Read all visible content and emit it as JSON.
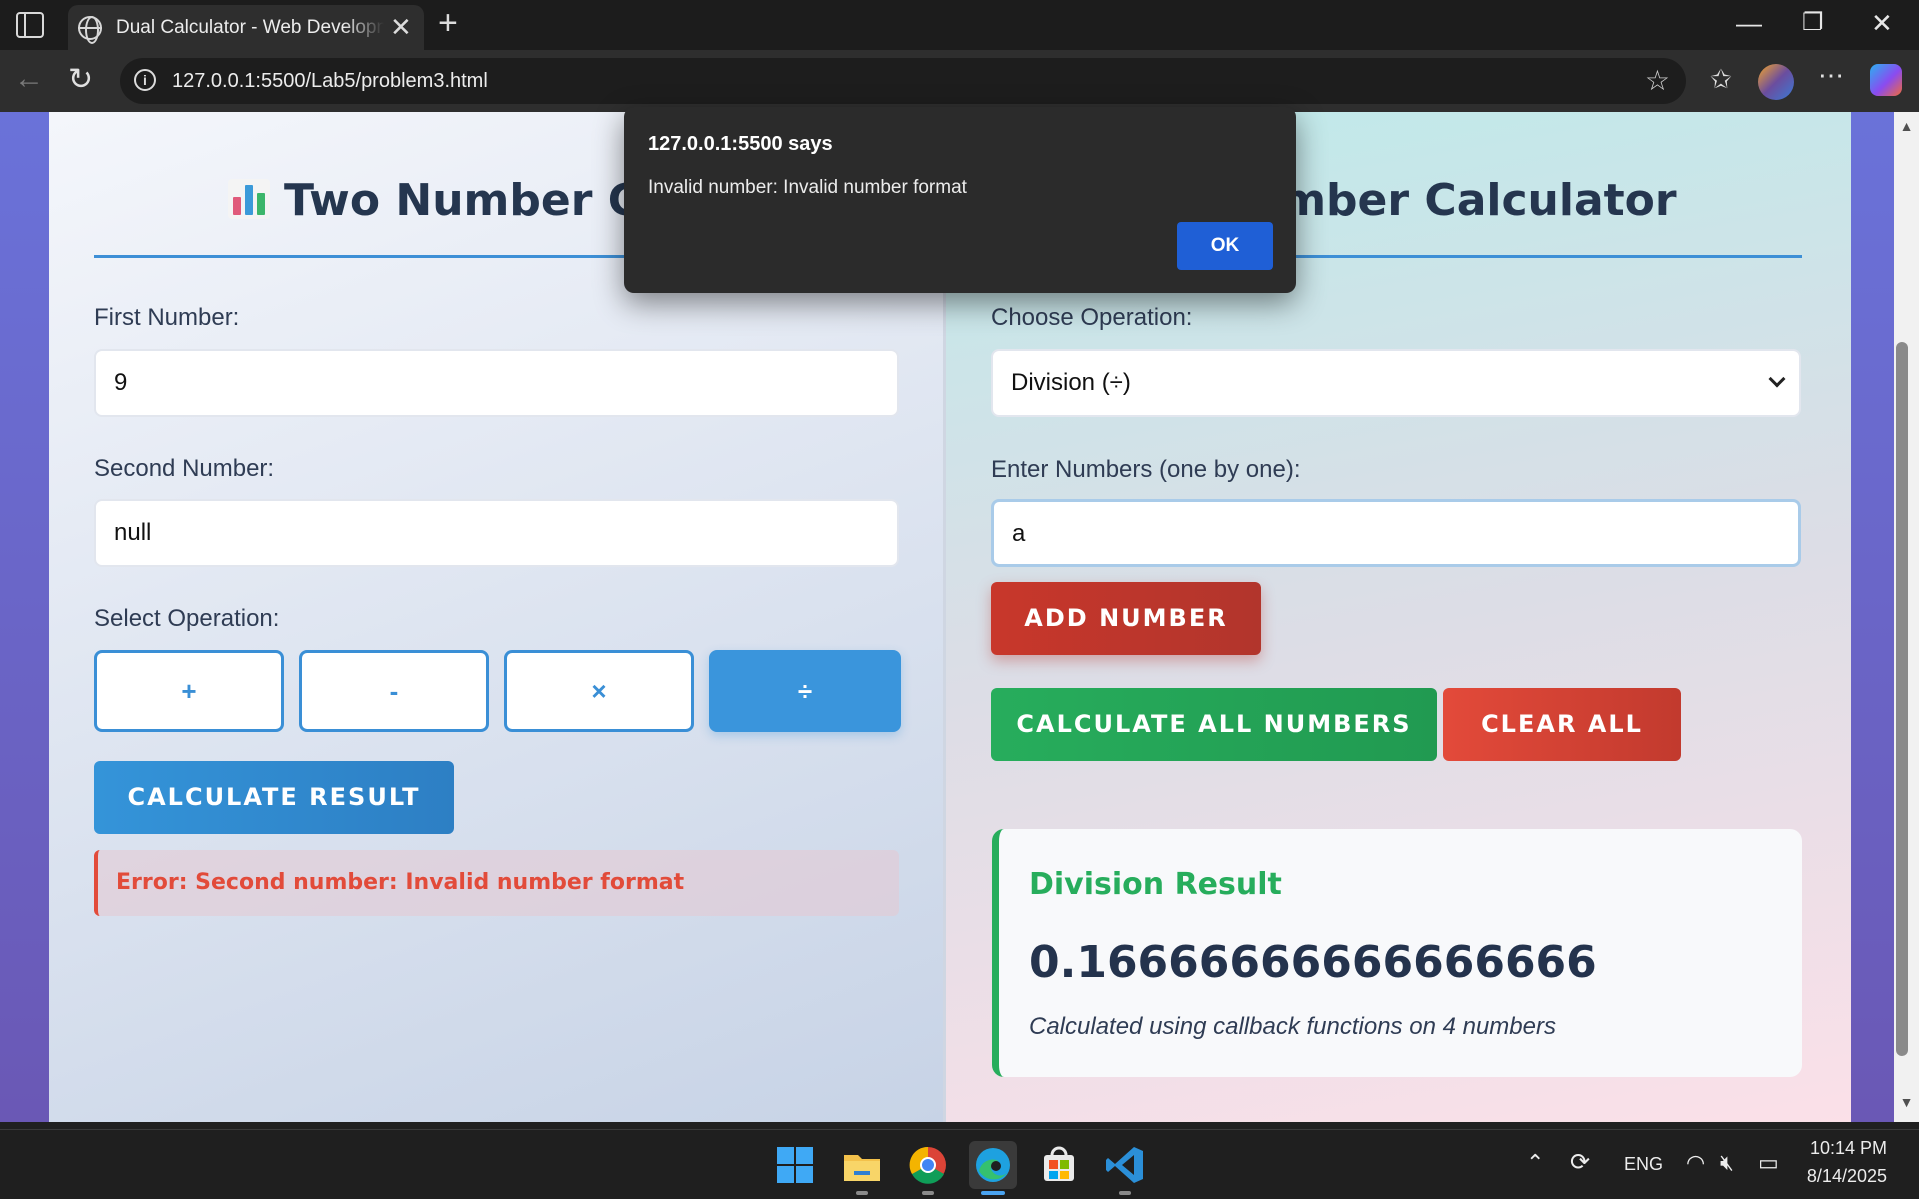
{
  "browser": {
    "tab_title": "Dual Calculator - Web Development",
    "url": "127.0.0.1:5500/Lab5/problem3.html",
    "icons": [
      "sidebar-icon",
      "globe-icon",
      "close-icon",
      "plus-icon",
      "minimize-icon",
      "restore-icon",
      "close-window-icon",
      "back-icon",
      "reload-icon",
      "info-icon",
      "star-icon",
      "favorites-icon",
      "more-icon",
      "copilot-icon"
    ]
  },
  "left_panel": {
    "title": "Two Number Calculator",
    "first_label": "First Number:",
    "first_value": "9",
    "second_label": "Second Number:",
    "second_value": "null",
    "op_label": "Select Operation:",
    "ops": [
      "+",
      "-",
      "×",
      "÷"
    ],
    "active_op": "÷",
    "calc_button": "CALCULATE RESULT",
    "error": "Error: Second number: Invalid number format"
  },
  "right_panel": {
    "title": "Multiple Number Calculator",
    "op_label": "Choose Operation:",
    "op_selected": "Division (÷)",
    "numbers_label": "Enter Numbers (one by one):",
    "numbers_value": "a",
    "add_button": "ADD NUMBER",
    "calc_all_button": "CALCULATE ALL NUMBERS",
    "clear_button": "CLEAR ALL",
    "result_title": "Division Result",
    "result_value": "0.16666666666666666",
    "result_note": "Calculated using callback functions on 4 numbers"
  },
  "dialog": {
    "title": "127.0.0.1:5500 says",
    "message": "Invalid number: Invalid number format",
    "ok": "OK"
  },
  "taskbar": {
    "apps": [
      "windows-start",
      "file-explorer",
      "chrome",
      "edge",
      "microsoft-store",
      "vscode"
    ],
    "language": "ENG",
    "time": "10:14 PM",
    "date": "8/14/2025"
  },
  "colors": {
    "accent_blue": "#3a95dc",
    "error_red": "#e24b3a",
    "success_green": "#27ad5c",
    "dialog_button": "#1f5fd6"
  }
}
